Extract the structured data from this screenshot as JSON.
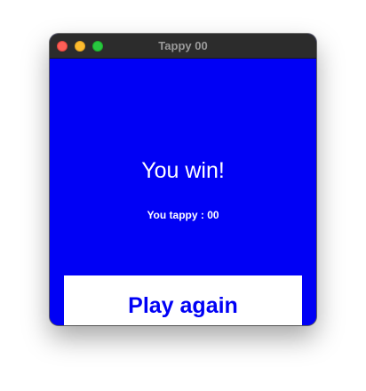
{
  "window": {
    "title": "Tappy 00"
  },
  "game": {
    "result_text": "You win!",
    "score_text": "You tappy : 00",
    "play_again_label": "Play again"
  },
  "colors": {
    "background": "#0000f5",
    "button_background": "#ffffff",
    "button_text": "#0000f5",
    "titlebar": "#2c2c2c"
  }
}
